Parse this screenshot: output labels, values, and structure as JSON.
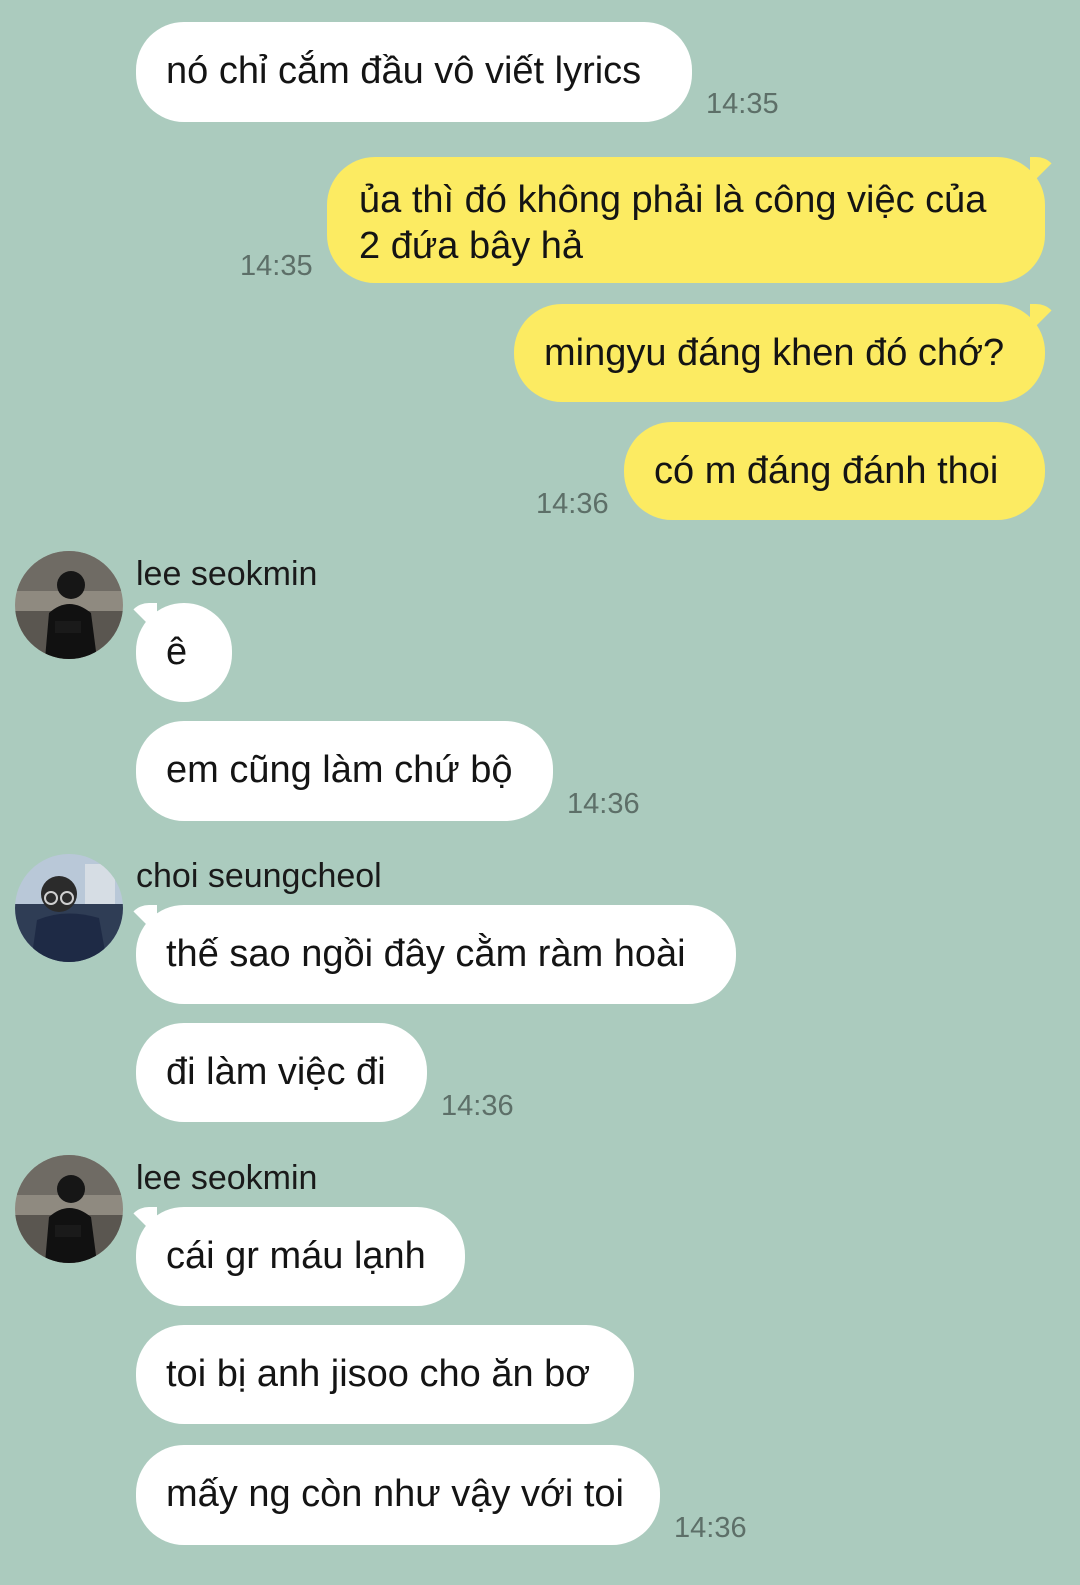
{
  "colors": {
    "background": "#abcbbe",
    "incoming_bubble": "#ffffff",
    "outgoing_bubble": "#fceb62",
    "timestamp": "#5d6f68"
  },
  "messages": [
    {
      "direction": "incoming",
      "text": "nó chỉ cắm đầu vô viết lyrics",
      "time": "14:35"
    },
    {
      "direction": "outgoing",
      "text": "ủa thì đó không phải là công việc của 2 đứa bây hả",
      "time": "14:35"
    },
    {
      "direction": "outgoing",
      "text": "mingyu đáng khen đó chớ?"
    },
    {
      "direction": "outgoing",
      "text": "có m đáng đánh thoi",
      "time": "14:36"
    },
    {
      "direction": "incoming",
      "sender": "lee seokmin",
      "avatar": "photo-avatar-dark",
      "text": "ê"
    },
    {
      "direction": "incoming",
      "text": "em cũng làm chứ bộ",
      "time": "14:36"
    },
    {
      "direction": "incoming",
      "sender": "choi seungcheol",
      "avatar": "photo-avatar-glasses",
      "text": "thế sao ngồi đây cằm ràm hoài"
    },
    {
      "direction": "incoming",
      "text": "đi làm việc đi",
      "time": "14:36"
    },
    {
      "direction": "incoming",
      "sender": "lee seokmin",
      "avatar": "photo-avatar-dark",
      "text": "cái gr máu lạnh"
    },
    {
      "direction": "incoming",
      "text": "toi bị anh jisoo cho ăn bơ"
    },
    {
      "direction": "incoming",
      "text": "mấy ng còn như vậy với toi",
      "time": "14:36"
    }
  ]
}
